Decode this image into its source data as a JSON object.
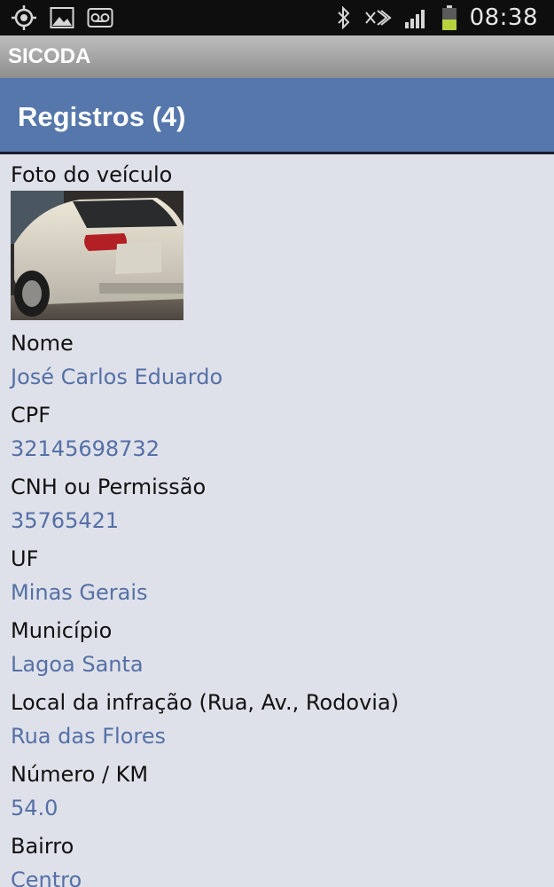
{
  "status_bar": {
    "time": "08:38",
    "left_icons": [
      "gps-icon",
      "gallery-icon",
      "voicemail-icon"
    ],
    "right_icons": [
      "bluetooth-icon",
      "nfc-icon",
      "signal-icon",
      "battery-icon"
    ]
  },
  "app": {
    "title": "SICODA"
  },
  "header": {
    "title": "Registros (4)"
  },
  "record": {
    "photo_label": "Foto do veículo",
    "fields": [
      {
        "label": "Nome",
        "value": "José Carlos Eduardo"
      },
      {
        "label": "CPF",
        "value": "32145698732"
      },
      {
        "label": "CNH ou Permissão",
        "value": "35765421"
      },
      {
        "label": "UF",
        "value": "Minas Gerais"
      },
      {
        "label": "Município",
        "value": "Lagoa Santa"
      },
      {
        "label": "Local da infração (Rua, Av., Rodovia)",
        "value": "Rua das Flores"
      },
      {
        "label": "Número / KM",
        "value": "54.0"
      },
      {
        "label": "Bairro",
        "value": "Centro"
      }
    ]
  },
  "colors": {
    "header_bg": "#5577ab",
    "value_text": "#5470a6",
    "content_bg": "#dfe1ea"
  }
}
